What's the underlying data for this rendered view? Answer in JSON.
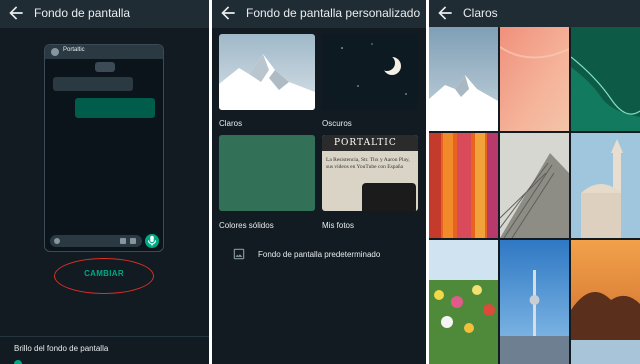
{
  "panel1": {
    "title": "Fondo de pantalla",
    "preview_contact": "Portaltic",
    "change_button": "CAMBIAR",
    "brightness_label": "Brillo del fondo de pantalla"
  },
  "panel2": {
    "title": "Fondo de pantalla personalizado",
    "categories": [
      {
        "label": "Claros"
      },
      {
        "label": "Oscuros"
      },
      {
        "label": "Colores sólidos"
      },
      {
        "label": "Mis fotos"
      }
    ],
    "photo_brand": "PORTALTIC",
    "photo_text": "La Resistencia, Str. Thx y Aaron Play, sus vídeos en YouTube con España",
    "default_label": "Fondo de pantalla predeterminado"
  },
  "panel3": {
    "title": "Claros",
    "thumbnails": [
      "snowy-peak",
      "coral-pink",
      "emerald-waves",
      "orange-curtains",
      "stone-pyramid",
      "mosque-minaret",
      "flower-field",
      "city-tower",
      "sunset-bay"
    ]
  },
  "colors": {
    "background": "#111b21",
    "topbar": "#1f2c34",
    "accent": "#00a884",
    "highlight": "#d93025"
  }
}
